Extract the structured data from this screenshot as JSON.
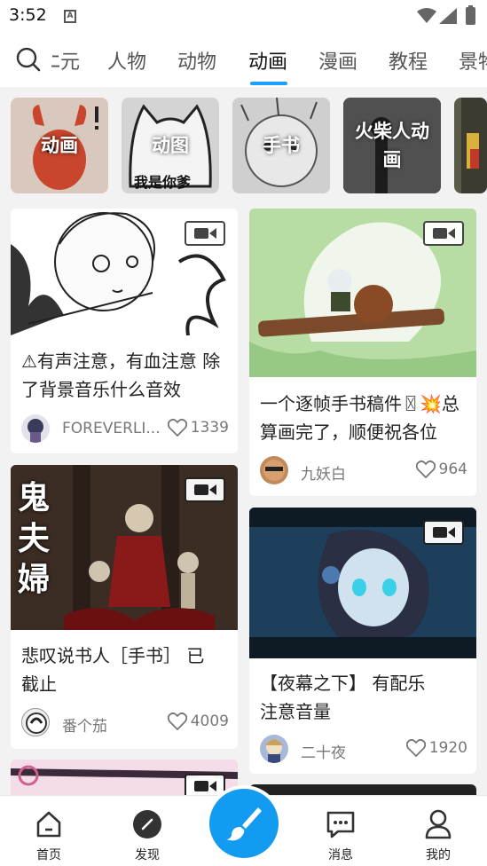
{
  "status_bar": {
    "time": "3:52",
    "sim_label": "A"
  },
  "tabs": [
    "ﾆ元",
    "人物",
    "动物",
    "动画",
    "漫画",
    "教程",
    "景物"
  ],
  "active_tab": "动画",
  "categories": [
    {
      "label": "动画",
      "sublabel": ""
    },
    {
      "label": "动图",
      "sublabel": "我是你爹"
    },
    {
      "label": "手书",
      "sublabel": ""
    },
    {
      "label": "火柴人动画",
      "sublabel": ""
    }
  ],
  "cards": [
    {
      "title": "⚠有声注意，有血注意 除了背景音乐什么音效",
      "author": "FOREVERLI...",
      "likes": "1339"
    },
    {
      "title": "一个逐帧手书稿件〿💥总算画完了，顺便祝各位",
      "author": "九妖白",
      "likes": "964"
    },
    {
      "title": "悲叹说书人［手书］ 已截止",
      "author": "番个茄",
      "likes": "4009",
      "thumb_text": "鬼夫婦"
    },
    {
      "title": "【夜幕之下】 有配乐注意音量",
      "author": "二十夜",
      "likes": "1920"
    }
  ],
  "bottom_nav": [
    {
      "label": "首页",
      "icon": "home-icon"
    },
    {
      "label": "发现",
      "icon": "discover-icon"
    },
    {
      "label": "消息",
      "icon": "message-icon"
    },
    {
      "label": "我的",
      "icon": "profile-icon"
    }
  ],
  "colors": {
    "accent": "#1aa0ff",
    "fab": "#139bf2"
  }
}
